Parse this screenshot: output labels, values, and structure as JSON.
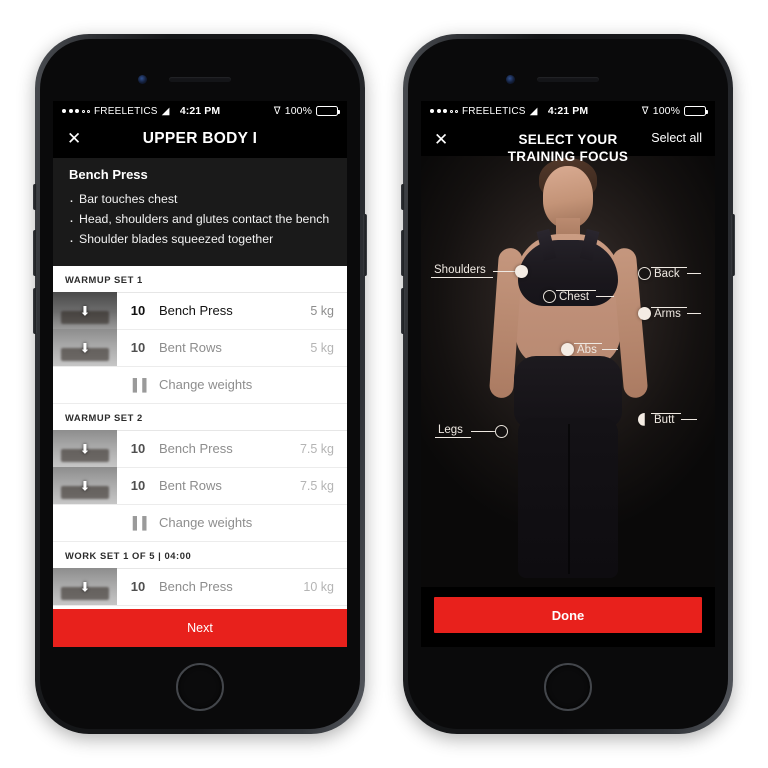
{
  "status_bar": {
    "carrier": "FREELETICS",
    "time": "4:21 PM",
    "battery_pct": "100%",
    "wifi_icon": "wifi-icon",
    "bluetooth_icon": "bluetooth-icon"
  },
  "left_phone": {
    "nav": {
      "close_icon": "✕",
      "title": "UPPER BODY I"
    },
    "instructions": {
      "exercise": "Bench Press",
      "bullets": [
        "Bar touches chest",
        "Head, shoulders and glutes contact the bench",
        "Shoulder blades squeezed together"
      ]
    },
    "sets": [
      {
        "header": "WARMUP SET 1",
        "rows": [
          {
            "type": "exercise",
            "reps": "10",
            "name": "Bench Press",
            "weight": "5 kg",
            "active": true,
            "thumb": "bench-press-thumb"
          },
          {
            "type": "exercise",
            "reps": "10",
            "name": "Bent Rows",
            "weight": "5 kg",
            "active": false,
            "thumb": "bent-rows-thumb"
          },
          {
            "type": "action",
            "icon": "▐▐",
            "name": "Change weights"
          }
        ]
      },
      {
        "header": "WARMUP SET 2",
        "rows": [
          {
            "type": "exercise",
            "reps": "10",
            "name": "Bench Press",
            "weight": "7.5 kg",
            "active": false,
            "thumb": "bench-press-thumb"
          },
          {
            "type": "exercise",
            "reps": "10",
            "name": "Bent Rows",
            "weight": "7.5 kg",
            "active": false,
            "thumb": "bent-rows-thumb"
          },
          {
            "type": "action",
            "icon": "▐▐",
            "name": "Change weights"
          }
        ]
      },
      {
        "header": "WORK SET 1 OF 5 | 04:00",
        "rows": [
          {
            "type": "exercise",
            "reps": "10",
            "name": "Bench Press",
            "weight": "10 kg",
            "active": false,
            "thumb": "bench-press-thumb"
          }
        ]
      }
    ],
    "next_button": "Next"
  },
  "right_phone": {
    "nav": {
      "close_icon": "✕",
      "title_line1": "SELECT YOUR",
      "title_line2": "TRAINING FOCUS",
      "select_all": "Select all"
    },
    "markers": [
      {
        "label": "Shoulders",
        "side": "left",
        "selected": true
      },
      {
        "label": "Chest",
        "side": "left",
        "selected": false
      },
      {
        "label": "Legs",
        "side": "left",
        "selected": false
      },
      {
        "label": "Back",
        "side": "right",
        "selected": false
      },
      {
        "label": "Arms",
        "side": "right",
        "selected": true
      },
      {
        "label": "Abs",
        "side": "right",
        "selected": true
      },
      {
        "label": "Butt",
        "side": "right",
        "selected": true
      }
    ],
    "done_button": "Done"
  },
  "colors": {
    "accent_red": "#e8211c",
    "screen_black": "#000000",
    "instruction_bg": "#1a1a1a"
  }
}
